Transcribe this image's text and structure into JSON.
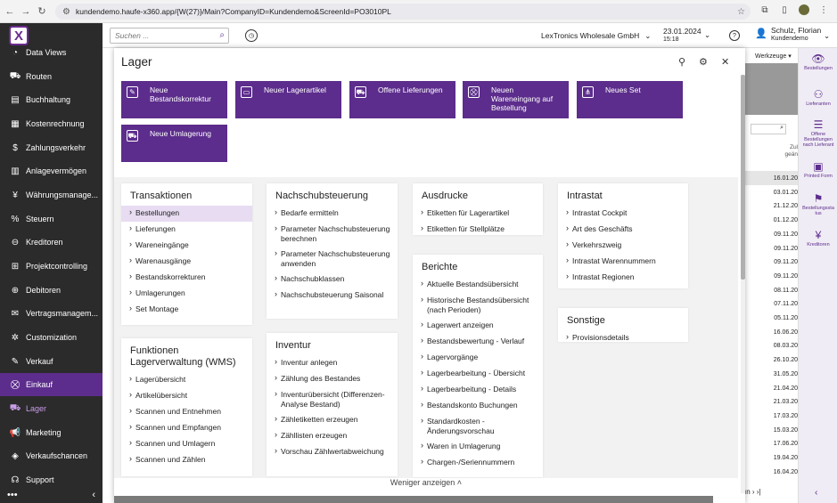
{
  "browser": {
    "url": "kundendemo.haufe-x360.app/{W(27)}/Main?CompanyID=Kundendemo&ScreenId=PO3010PL"
  },
  "sidebar": {
    "items": [
      {
        "label": "Data Views",
        "icon": "pie-chart-icon",
        "glyph": "◔"
      },
      {
        "label": "Routen",
        "icon": "truck-icon",
        "glyph": "⛟"
      },
      {
        "label": "Buchhaltung",
        "icon": "ledger-icon",
        "glyph": "▤"
      },
      {
        "label": "Kostenrechnung",
        "icon": "calculator-icon",
        "glyph": "▦"
      },
      {
        "label": "Zahlungsverkehr",
        "icon": "dollar-icon",
        "glyph": "$"
      },
      {
        "label": "Anlagevermögen",
        "icon": "building-icon",
        "glyph": "▥"
      },
      {
        "label": "Währungsmanage...",
        "icon": "currency-icon",
        "glyph": "¥"
      },
      {
        "label": "Steuern",
        "icon": "percent-icon",
        "glyph": "%"
      },
      {
        "label": "Kreditoren",
        "icon": "minus-circle-icon",
        "glyph": "⊖"
      },
      {
        "label": "Projektcontrolling",
        "icon": "project-icon",
        "glyph": "⊞"
      },
      {
        "label": "Debitoren",
        "icon": "plus-circle-icon",
        "glyph": "⊕"
      },
      {
        "label": "Vertragsmanagem...",
        "icon": "contract-icon",
        "glyph": "✉"
      },
      {
        "label": "Customization",
        "icon": "puzzle-icon",
        "glyph": "✲"
      },
      {
        "label": "Verkauf",
        "icon": "edit-icon",
        "glyph": "✎"
      },
      {
        "label": "Einkauf",
        "icon": "cart-icon",
        "glyph": "⛒"
      },
      {
        "label": "Lager",
        "icon": "truck-icon",
        "glyph": "⛟"
      },
      {
        "label": "Marketing",
        "icon": "megaphone-icon",
        "glyph": "📢"
      },
      {
        "label": "Verkaufschancen",
        "icon": "tag-icon",
        "glyph": "◈"
      },
      {
        "label": "Support",
        "icon": "headset-icon",
        "glyph": "☊"
      }
    ],
    "more": "•••",
    "collapse": "‹"
  },
  "topbar": {
    "search_placeholder": "Suchen ...",
    "company": "LexTronics Wholesale GmbH",
    "date": "23.01.2024",
    "time": "15:18",
    "user_name": "Schulz, Florian",
    "user_company": "Kundendemo"
  },
  "panel": {
    "title": "Lager",
    "tiles": [
      {
        "label": "Neue Bestandskorrektur",
        "glyph": "✎"
      },
      {
        "label": "Neuer Lagerartikel",
        "glyph": "▭"
      },
      {
        "label": "Offene Lieferungen",
        "glyph": "⛟"
      },
      {
        "label": "Neuen Wareneingang auf Bestellung",
        "glyph": "⛒"
      },
      {
        "label": "Neues Set",
        "glyph": "⋔"
      },
      {
        "label": "Neue Umlagerung",
        "glyph": "⛟"
      }
    ],
    "transaktionen": {
      "title": "Transaktionen",
      "links": [
        "Bestellungen",
        "Lieferungen",
        "Wareneingänge",
        "Warenausgänge",
        "Bestandskorrekturen",
        "Umlagerungen",
        "Set Montage"
      ]
    },
    "funktionen": {
      "title": "Funktionen Lagerverwaltung (WMS)",
      "links": [
        "Lagerübersicht",
        "Artikelübersicht",
        "Scannen und Entnehmen",
        "Scannen und Empfangen",
        "Scannen und Umlagern",
        "Scannen und Zählen"
      ]
    },
    "nachschub": {
      "title": "Nachschubsteuerung",
      "links": [
        "Bedarfe ermitteln",
        "Parameter Nachschubsteuerung berechnen",
        "Parameter Nachschubsteuerung anwenden",
        "Nachschubklassen",
        "Nachschubsteuerung Saisonal"
      ]
    },
    "inventur": {
      "title": "Inventur",
      "links": [
        "Inventur anlegen",
        "Zählung des Bestandes",
        "Inventurübersicht (Differenzen-Analyse Bestand)",
        "Zähletiketten erzeugen",
        "Zähllisten erzeugen",
        "Vorschau Zählwertabweichung"
      ]
    },
    "ausdrucke": {
      "title": "Ausdrucke",
      "links": [
        "Etiketten für Lagerartikel",
        "Etiketten für Stellplätze"
      ]
    },
    "berichte": {
      "title": "Berichte",
      "links": [
        "Aktuelle Bestandsübersicht",
        "Historische Bestandsübersicht (nach Perioden)",
        "Lagerwert anzeigen",
        "Bestandsbewertung - Verlauf",
        "Lagervorgänge",
        "Lagerbearbeitung - Übersicht",
        "Lagerbearbeitung - Details",
        "Bestandskonto Buchungen",
        "Standardkosten - Änderungsvorschau",
        "Waren in Umlagerung",
        "Chargen-/Seriennummern"
      ]
    },
    "intrastat": {
      "title": "Intrastat",
      "links": [
        "Intrastat Cockpit",
        "Art des Geschäfts",
        "Verkehrszweig",
        "Intrastat Warennummern",
        "Intrastat Regionen"
      ]
    },
    "sonstige": {
      "title": "Sonstige",
      "links": [
        "Provisionsdetails"
      ]
    },
    "footer": "Weniger anzeigen ˄"
  },
  "background": {
    "werkzeuge": "Werkzeuge ▾",
    "header": "Zul\ngeän",
    "dates": [
      "16.01.20",
      "03.01.20",
      "21.12.20",
      "01.12.20",
      "09.11.20",
      "09.11.20",
      "09.11.20",
      "09.11.20",
      "08.11.20",
      "07.11.20",
      "05.11.20",
      "16.06.20",
      "08.03.20",
      "26.10.20",
      "31.05.20",
      "21.04.20",
      "21.03.20",
      "17.03.20",
      "15.03.20",
      "17.06.20",
      "19.04.20",
      "16.04.20"
    ],
    "pager": "ın ›  ›|"
  },
  "right_actions": [
    {
      "label": "Bestellungen",
      "glyph": "👁"
    },
    {
      "label": "Lieferanten",
      "glyph": "⚇"
    },
    {
      "label": "Offene Bestellungen nach Lieferant",
      "glyph": "☰"
    },
    {
      "label": "Printed Form",
      "glyph": "▣"
    },
    {
      "label": "Bestellungssta tus",
      "glyph": "⚑"
    },
    {
      "label": "Kreditoren",
      "glyph": "¥"
    }
  ]
}
